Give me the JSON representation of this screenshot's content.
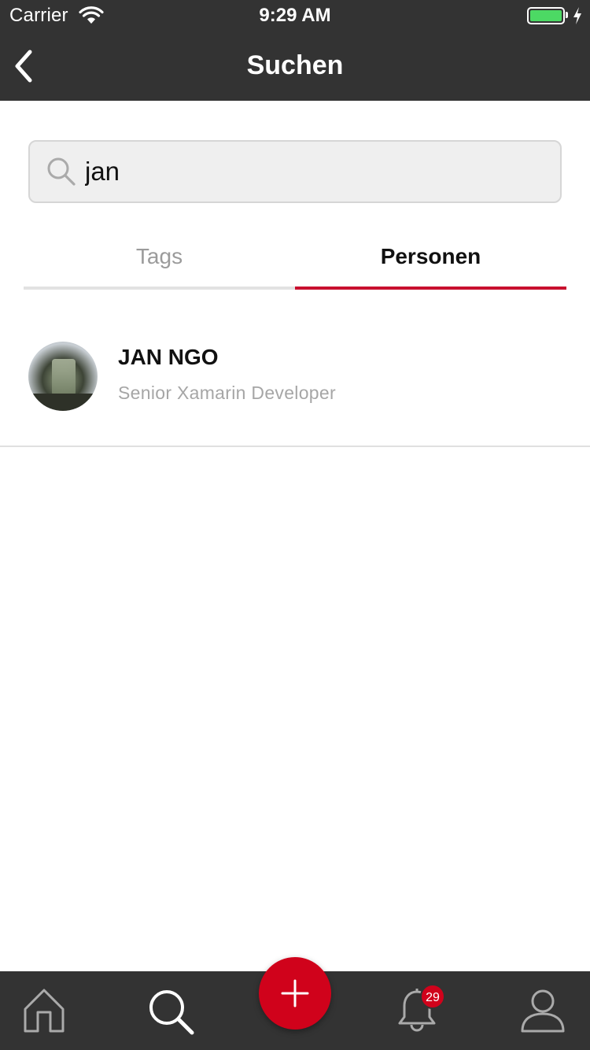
{
  "status_bar": {
    "carrier": "Carrier",
    "time": "9:29 AM",
    "wifi_icon": "wifi-icon",
    "battery_icon": "battery-icon",
    "charging_icon": "bolt-icon",
    "battery_color": "#4cd964"
  },
  "nav": {
    "back_icon": "chevron-left-icon",
    "title": "Suchen"
  },
  "search": {
    "icon": "search-icon",
    "value": "jan"
  },
  "tabs": [
    {
      "label": "Tags",
      "active": false
    },
    {
      "label": "Personen",
      "active": true
    }
  ],
  "results": [
    {
      "name": "JAN NGO",
      "subtitle": "Senior Xamarin Developer",
      "avatar": "avatar-photo"
    }
  ],
  "tab_bar": {
    "items": [
      {
        "icon": "home-icon"
      },
      {
        "icon": "search-icon"
      },
      {
        "icon": "bell-icon",
        "badge": "29"
      },
      {
        "icon": "user-icon"
      }
    ],
    "fab_icon": "plus-icon"
  },
  "colors": {
    "bar_background": "#333333",
    "accent": "#c8102e",
    "fab": "#d0021b",
    "muted_text": "#9b9b9b"
  }
}
